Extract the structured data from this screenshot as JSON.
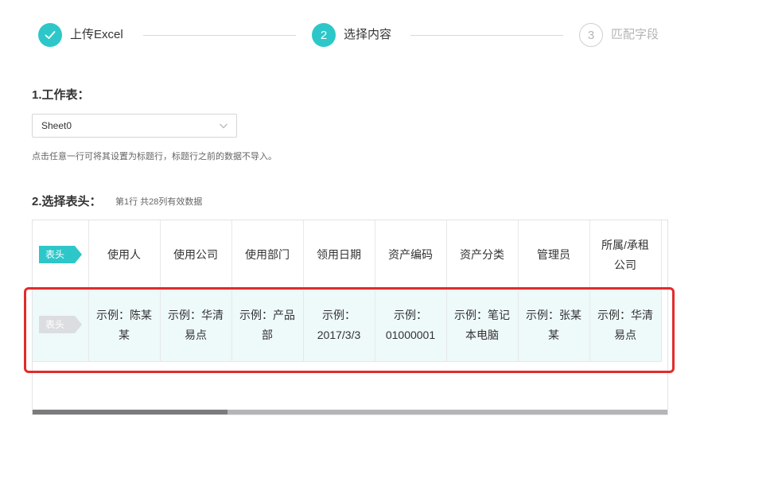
{
  "steps": [
    {
      "number": "",
      "label": "上传Excel",
      "state": "done"
    },
    {
      "number": "2",
      "label": "选择内容",
      "state": "active"
    },
    {
      "number": "3",
      "label": "匹配字段",
      "state": "todo"
    }
  ],
  "colors": {
    "accent": "#2ec7c9",
    "highlight": "#e22b2b",
    "row_bg": "#eef9f9",
    "tag_inactive": "#dcdde0"
  },
  "worksheet": {
    "title": "1.工作表：",
    "selected": "Sheet0",
    "hint": "点击任意一行可将其设置为标题行，标题行之前的数据不导入。"
  },
  "header_select": {
    "title": "2.选择表头：",
    "info": "第1行 共28列有效数据"
  },
  "table": {
    "rows": [
      {
        "tag": "表头",
        "active": true,
        "cells": [
          "使用人",
          "使用公司",
          "使用部门",
          "领用日期",
          "资产编码",
          "资产分类",
          "管理员",
          "所属/承租公司"
        ]
      },
      {
        "tag": "表头",
        "active": false,
        "cells": [
          "示例：陈某某",
          "示例：华清易点",
          "示例：产品部",
          "示例：2017/3/3",
          "示例：01000001",
          "示例：笔记本电脑",
          "示例：张某某",
          "示例：华清易点"
        ]
      }
    ]
  }
}
